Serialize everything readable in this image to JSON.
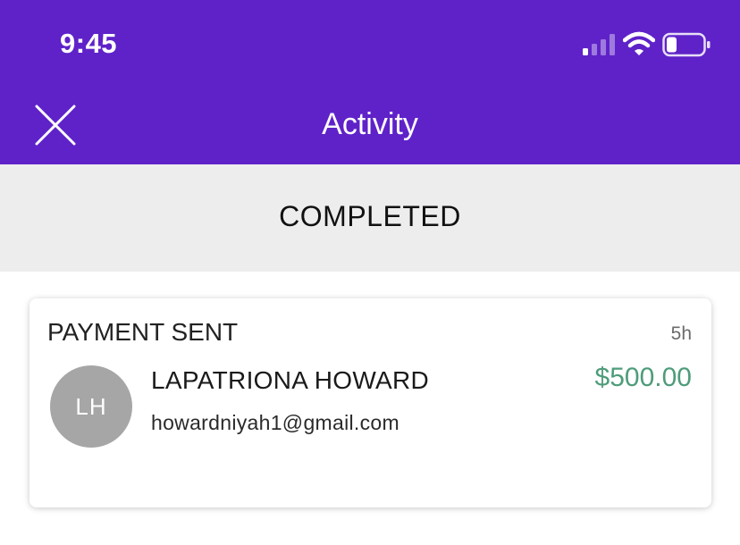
{
  "status_bar": {
    "time": "9:45",
    "icons": [
      "cellular-signal-icon",
      "wifi-icon",
      "battery-icon"
    ]
  },
  "nav": {
    "title": "Activity",
    "close_icon": "close-icon"
  },
  "section": {
    "title": "COMPLETED"
  },
  "transaction": {
    "type": "PAYMENT SENT",
    "time_ago": "5h",
    "avatar_initials": "LH",
    "name": "LAPATRIONA HOWARD",
    "email": "howardniyah1@gmail.com",
    "amount": "$500.00"
  },
  "colors": {
    "header_bg": "#5f22c9",
    "section_bg": "#ededed",
    "amount": "#4e9c7a",
    "avatar_bg": "#a6a6a6"
  }
}
